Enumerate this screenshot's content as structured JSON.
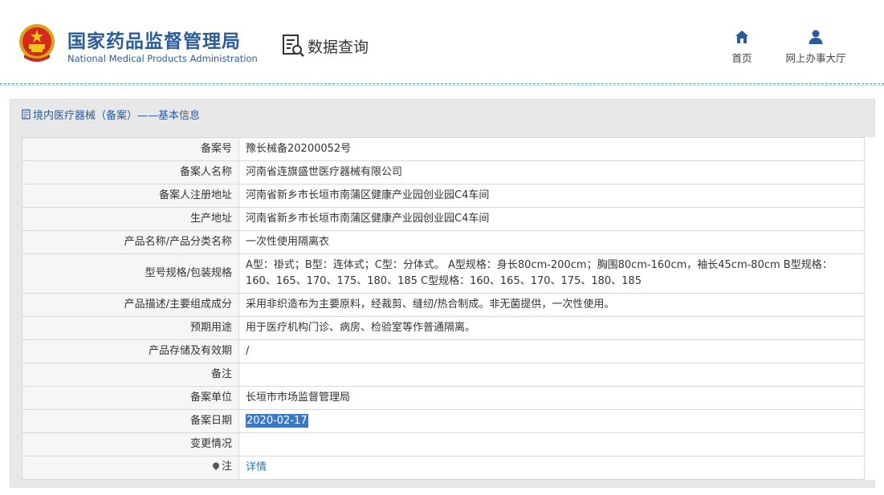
{
  "header": {
    "brand_cn": "国家药品监督管理局",
    "brand_en": "National Medical Products Administration",
    "section_label": "数据查询",
    "nav": [
      {
        "label": "首页",
        "icon": "home-icon"
      },
      {
        "label": "网上办事大厅",
        "icon": "user-icon"
      }
    ],
    "accent_color": "#2a5c9a"
  },
  "panel": {
    "title": "境内医疗器械（备案）——基本信息",
    "title_icon": "document-icon"
  },
  "record": {
    "rows": [
      {
        "key": "备案号",
        "value": "豫长械备20200052号"
      },
      {
        "key": "备案人名称",
        "value": "河南省连旗盛世医疗器械有限公司"
      },
      {
        "key": "备案人注册地址",
        "value": "河南省新乡市长垣市南蒲区健康产业园创业园C4车间"
      },
      {
        "key": "生产地址",
        "value": "河南省新乡市长垣市南蒲区健康产业园创业园C4车间"
      },
      {
        "key": "产品名称/产品分类名称",
        "value": "一次性使用隔离衣"
      },
      {
        "key": "型号规格/包装规格",
        "value": "A型：褂式；B型：连体式；C型：分体式。 A型规格：身长80cm-200cm；胸围80cm-160cm，袖长45cm-80cm B型规格：160、165、170、175、180、185 C型规格：160、165、170、175、180、185"
      },
      {
        "key": "产品描述/主要组成成分",
        "value": "采用非织造布为主要原料，经裁剪、缝纫/热合制成。非无菌提供，一次性使用。"
      },
      {
        "key": "预期用途",
        "value": "用于医疗机构门诊、病房、检验室等作普通隔离。"
      },
      {
        "key": "产品存储及有效期",
        "value": "/"
      },
      {
        "key": "备注",
        "value": ""
      },
      {
        "key": "备案单位",
        "value": "长垣市市场监督管理局"
      },
      {
        "key": "备案日期",
        "value": "2020-02-17"
      },
      {
        "key": "变更情况",
        "value": ""
      },
      {
        "key": "注",
        "value": "详情",
        "key_icon": "info-pin-icon"
      }
    ],
    "selected_color": "#3b78c6",
    "link_color": "#2a7ac0"
  }
}
